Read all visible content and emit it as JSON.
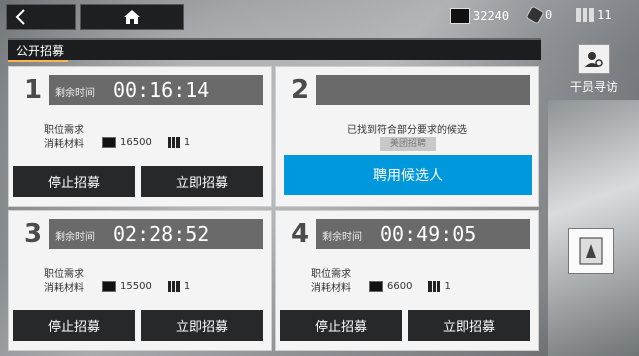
{
  "header": {
    "title": "公开招募"
  },
  "resources": {
    "materials": "32240",
    "originite": "0",
    "permits": "11"
  },
  "sidebar": {
    "guide_label": "干员寻访"
  },
  "slots": [
    {
      "number": "1",
      "time_label": "剩余时间",
      "time": "00:16:14",
      "req_label": "职位需求",
      "cost_label": "消耗材料",
      "cost_amount": "16500",
      "permit_amount": "1",
      "stop_label": "停止招募",
      "instant_label": "立即招募"
    },
    {
      "number": "2",
      "found_text": "已找到符合部分要求的候选",
      "tag": "美团招聘",
      "hire_label": "聘用候选人"
    },
    {
      "number": "3",
      "time_label": "剩余时间",
      "time": "02:28:52",
      "req_label": "职位需求",
      "cost_label": "消耗材料",
      "cost_amount": "15500",
      "permit_amount": "1",
      "stop_label": "停止招募",
      "instant_label": "立即招募"
    },
    {
      "number": "4",
      "time_label": "剩余时间",
      "time": "00:49:05",
      "req_label": "职位需求",
      "cost_label": "消耗材料",
      "cost_amount": "6600",
      "permit_amount": "1",
      "stop_label": "停止招募",
      "instant_label": "立即招募"
    }
  ]
}
